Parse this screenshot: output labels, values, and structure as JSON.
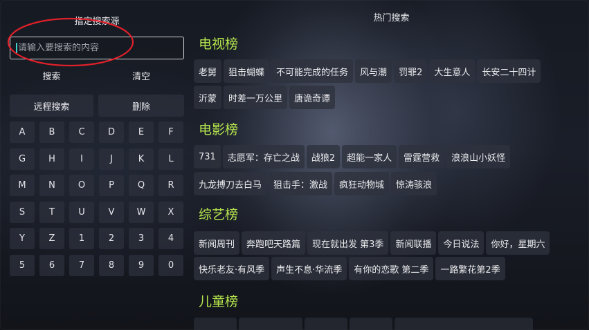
{
  "left": {
    "source_title": "指定搜索源",
    "search_placeholder": "请输入要搜索的内容",
    "search_label": "搜索",
    "clear_label": "清空",
    "remote_search_label": "远程搜索",
    "delete_label": "删除",
    "keys": [
      "A",
      "B",
      "C",
      "D",
      "E",
      "F",
      "G",
      "H",
      "I",
      "J",
      "K",
      "L",
      "M",
      "N",
      "O",
      "P",
      "Q",
      "R",
      "S",
      "T",
      "U",
      "V",
      "W",
      "X",
      "Y",
      "Z",
      "1",
      "2",
      "3",
      "4",
      "5",
      "6",
      "7",
      "8",
      "9",
      "0"
    ]
  },
  "right": {
    "title": "热门搜索",
    "sections": [
      {
        "title": "电视榜",
        "rows": [
          [
            "老舅",
            "狙击蝴蝶",
            "不可能完成的任务",
            "风与潮",
            "罚罪2",
            "大生意人",
            "长安二十四计"
          ],
          [
            "沂蒙",
            "时差一万公里",
            "唐诡奇谭"
          ]
        ]
      },
      {
        "title": "电影榜",
        "rows": [
          [
            "731",
            "志愿军：存亡之战",
            "战狼2",
            "超能一家人",
            "雷霆营救",
            "浪浪山小妖怪"
          ],
          [
            "九龙搏刀去白马",
            "狙击手：激战",
            "疯狂动物城",
            "惊涛骇浪"
          ]
        ]
      },
      {
        "title": "综艺榜",
        "rows": [
          [
            "新闻周刊",
            "奔跑吧天路篇",
            "现在就出发 第3季",
            "新闻联播",
            "今日说法",
            "你好，星期六"
          ],
          [
            "快乐老友·有风季",
            "声生不息·华流季",
            "有你的恋歌 第二季",
            "一路繁花第2季"
          ]
        ]
      },
      {
        "title": "儿童榜",
        "rows": []
      }
    ]
  },
  "colors": {
    "section_title": "#b4e44c",
    "annotation_ellipse": "#e0202a",
    "cursor": "#3fd0c9"
  }
}
